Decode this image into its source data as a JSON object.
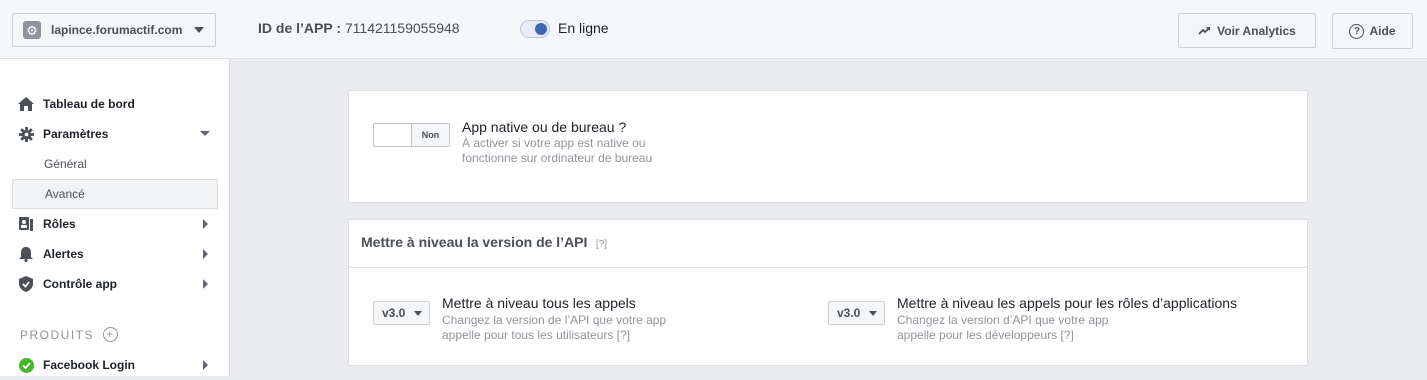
{
  "topbar": {
    "app_name": "lapince.forumactif.com",
    "app_id_label": "ID de l’APP :",
    "app_id_value": "711421159055948",
    "online_label": "En ligne",
    "online_enabled": true,
    "analytics_label": "Voir Analytics",
    "help_label": "Aide"
  },
  "sidebar": {
    "items": [
      {
        "label": "Tableau de bord",
        "icon": "home-icon"
      },
      {
        "label": "Paramètres",
        "icon": "gear-icon",
        "expanded": true
      },
      {
        "label": "Général"
      },
      {
        "label": "Avancé",
        "active": true
      },
      {
        "label": "Rôles",
        "icon": "roles-icon"
      },
      {
        "label": "Alertes",
        "icon": "bell-icon"
      },
      {
        "label": "Contrôle app",
        "icon": "shield-icon"
      }
    ],
    "products_header": "PRODUITS",
    "products": [
      {
        "label": "Facebook Login",
        "icon": "check-circle-icon",
        "status_color": "#42b72a"
      }
    ]
  },
  "native_app": {
    "toggle_value": "Non",
    "title": "App native ou de bureau ?",
    "description": "À activer si votre app est native ou fonctionne sur ordinateur de bureau"
  },
  "api_upgrade": {
    "title": "Mettre à niveau la version de l’API",
    "help_mark": "[?]",
    "all_calls": {
      "version": "v3.0",
      "title": "Mettre à niveau tous les appels",
      "description": "Changez la version de l’API que votre app appelle pour tous les utilisateurs [?]"
    },
    "roles_calls": {
      "version": "v3.0",
      "title": "Mettre à niveau les appels pour les rôles d’applications",
      "description": "Changez la version d’API que votre app appelle pour les développeurs [?]"
    }
  },
  "colors": {
    "accent": "#4267b2",
    "background": "#e9ebee",
    "success": "#42b72a"
  }
}
